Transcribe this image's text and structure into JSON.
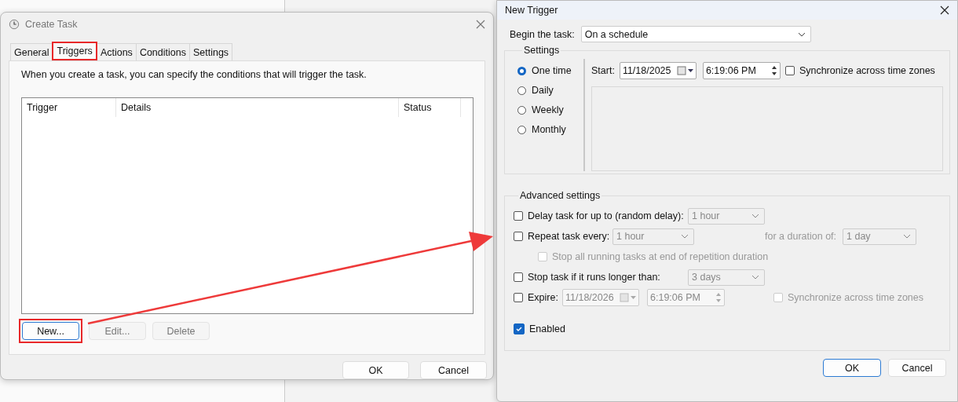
{
  "create_task": {
    "title": "Create Task",
    "tabs": [
      {
        "label": "General",
        "selected": false,
        "highlighted": false
      },
      {
        "label": "Triggers",
        "selected": true,
        "highlighted": true
      },
      {
        "label": "Actions",
        "selected": false,
        "highlighted": false
      },
      {
        "label": "Conditions",
        "selected": false,
        "highlighted": false
      },
      {
        "label": "Settings",
        "selected": false,
        "highlighted": false
      }
    ],
    "description": "When you create a task, you can specify the conditions that will trigger the task.",
    "columns": [
      "Trigger",
      "Details",
      "Status"
    ],
    "buttons": [
      {
        "label": "New...",
        "disabled": false,
        "focused": true,
        "highlighted": true
      },
      {
        "label": "Edit...",
        "disabled": true,
        "focused": false,
        "highlighted": false
      },
      {
        "label": "Delete",
        "disabled": true,
        "focused": false,
        "highlighted": false
      }
    ],
    "footer_buttons": [
      {
        "label": "OK"
      },
      {
        "label": "Cancel"
      }
    ]
  },
  "new_trigger": {
    "title": "New Trigger",
    "begin_label": "Begin the task:",
    "begin_value": "On a schedule",
    "settings": {
      "legend": "Settings",
      "schedules": [
        {
          "label": "One time",
          "selected": true
        },
        {
          "label": "Daily",
          "selected": false
        },
        {
          "label": "Weekly",
          "selected": false
        },
        {
          "label": "Monthly",
          "selected": false
        }
      ],
      "start_label": "Start:",
      "start_date": "11/18/2025",
      "start_time": "6:19:06 PM",
      "sync": {
        "label": "Synchronize across time zones",
        "checked": false
      }
    },
    "advanced": {
      "legend": "Advanced settings",
      "delay": {
        "label": "Delay task for up to (random delay):",
        "checked": false,
        "value": "1 hour"
      },
      "repeat": {
        "label": "Repeat task every:",
        "checked": false,
        "value": "1 hour",
        "duration_label": "for a duration of:",
        "duration_value": "1 day"
      },
      "stop_all": {
        "label": "Stop all running tasks at end of repetition duration",
        "checked": false,
        "disabled": true
      },
      "stop": {
        "label": "Stop task if it runs longer than:",
        "checked": false,
        "value": "3 days"
      },
      "expire": {
        "label": "Expire:",
        "checked": false,
        "date": "11/18/2026",
        "time": "6:19:06 PM",
        "sync_label": "Synchronize across time zones",
        "sync_checked": false
      },
      "enabled": {
        "label": "Enabled",
        "checked": true
      }
    },
    "buttons": [
      {
        "label": "OK",
        "focused": true
      },
      {
        "label": "Cancel",
        "focused": false
      }
    ]
  }
}
